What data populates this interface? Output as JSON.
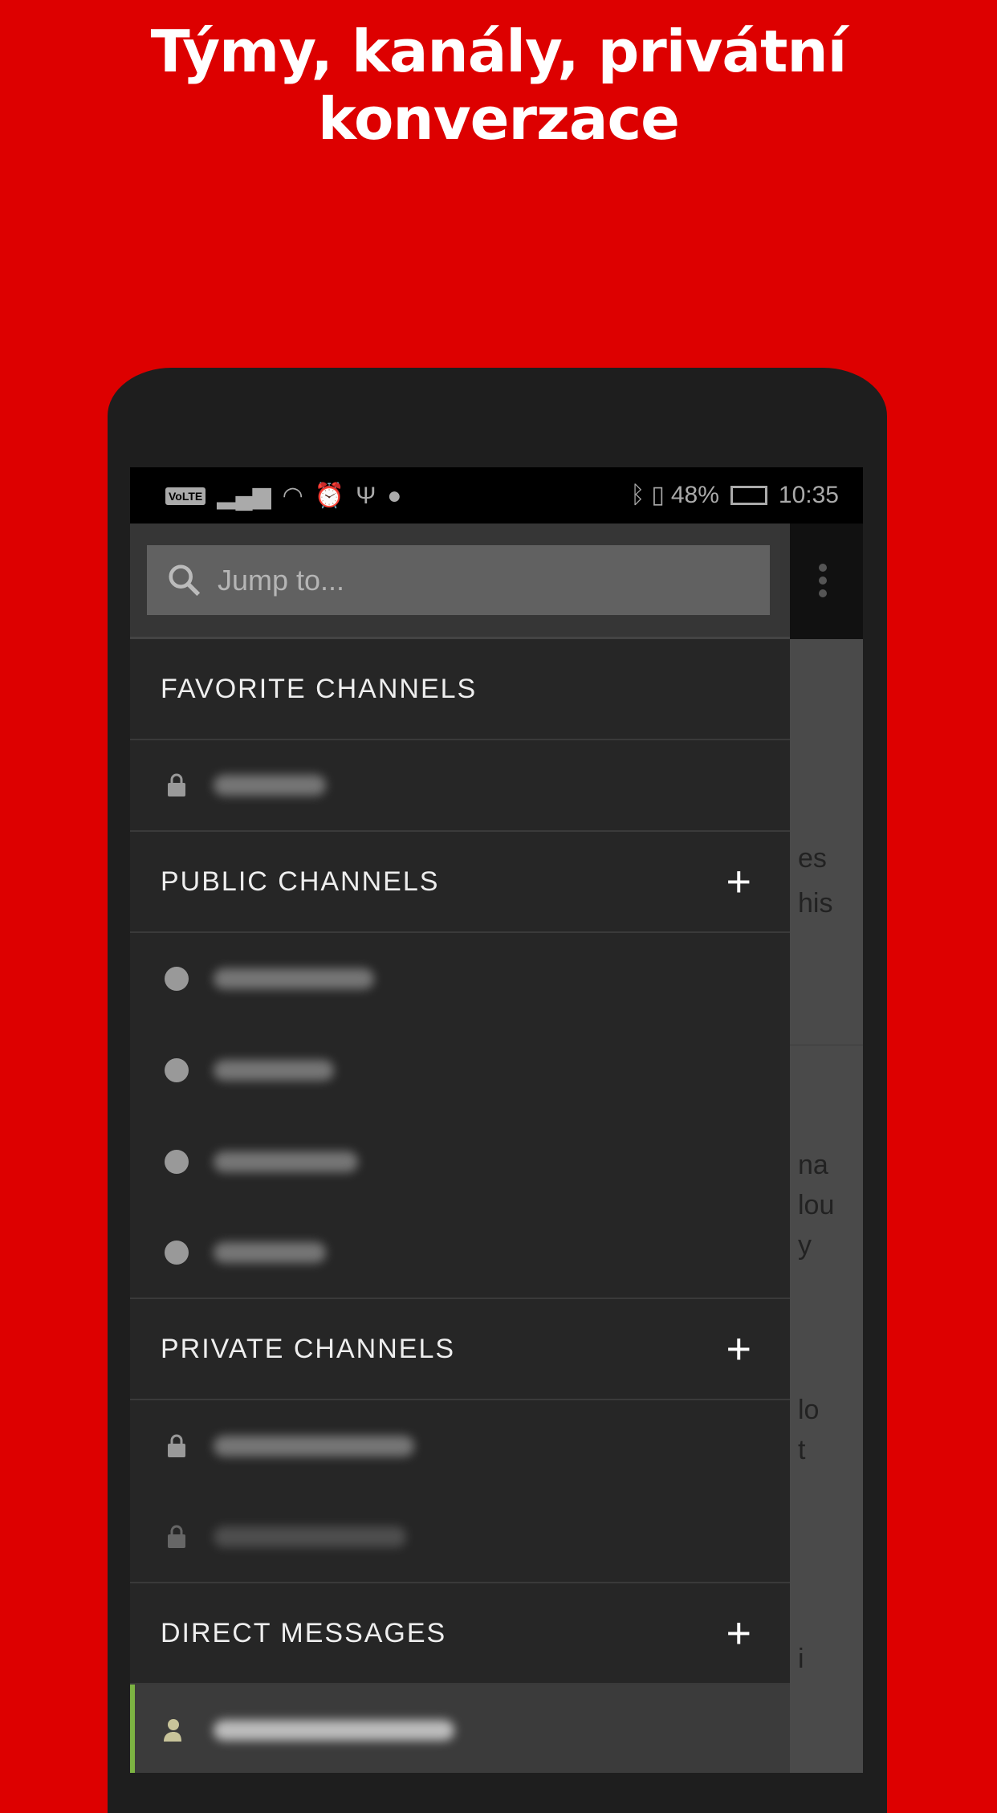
{
  "headline": "Týmy, kanály, privátní konverzace",
  "status_bar": {
    "volte": "VoLTE",
    "battery": "48%",
    "time": "10:35",
    "icons": [
      "signal-icon",
      "wifi-icon",
      "alarm-icon",
      "usb-icon",
      "chat-bubble-icon",
      "bluetooth-icon",
      "vibrate-icon",
      "battery-charging-icon"
    ]
  },
  "search": {
    "placeholder": "Jump to..."
  },
  "sections": {
    "favorite": {
      "label": "FAVORITE CHANNELS"
    },
    "public": {
      "label": "PUBLIC CHANNELS",
      "add": "+"
    },
    "private": {
      "label": "PRIVATE CHANNELS",
      "add": "+"
    },
    "direct": {
      "label": "DIRECT MESSAGES",
      "add": "+"
    }
  },
  "background_fragments": [
    "es",
    "his",
    "na",
    "lou",
    "y",
    "lo",
    "t",
    "i"
  ],
  "colors": {
    "background": "#dd0000",
    "drawer": "#262626",
    "active_indicator": "#7cb342"
  }
}
